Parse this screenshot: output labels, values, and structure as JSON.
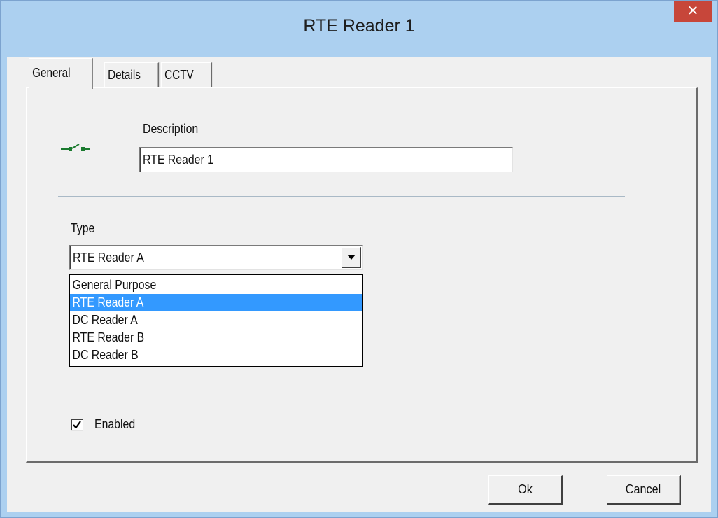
{
  "window": {
    "title": "RTE Reader 1",
    "close_label": "✕"
  },
  "tabs": [
    {
      "label": "General",
      "active": true
    },
    {
      "label": "Details",
      "active": false
    },
    {
      "label": "CCTV",
      "active": false
    }
  ],
  "general": {
    "icon": "rte-switch-icon",
    "description_label": "Description",
    "description_value": "RTE Reader 1",
    "type_label": "Type",
    "type_value": "RTE Reader A",
    "type_options": [
      "General Purpose",
      "RTE Reader A",
      "DC Reader A",
      "RTE Reader B",
      "DC Reader B"
    ],
    "type_selected_index": 1,
    "enabled_label": "Enabled",
    "enabled_checked": true
  },
  "buttons": {
    "ok_label": "Ok",
    "cancel_label": "Cancel"
  },
  "colors": {
    "title_bar": "#acd0f0",
    "close_button": "#c7463a",
    "selection": "#3399ff",
    "icon_green": "#1a7a2e"
  }
}
